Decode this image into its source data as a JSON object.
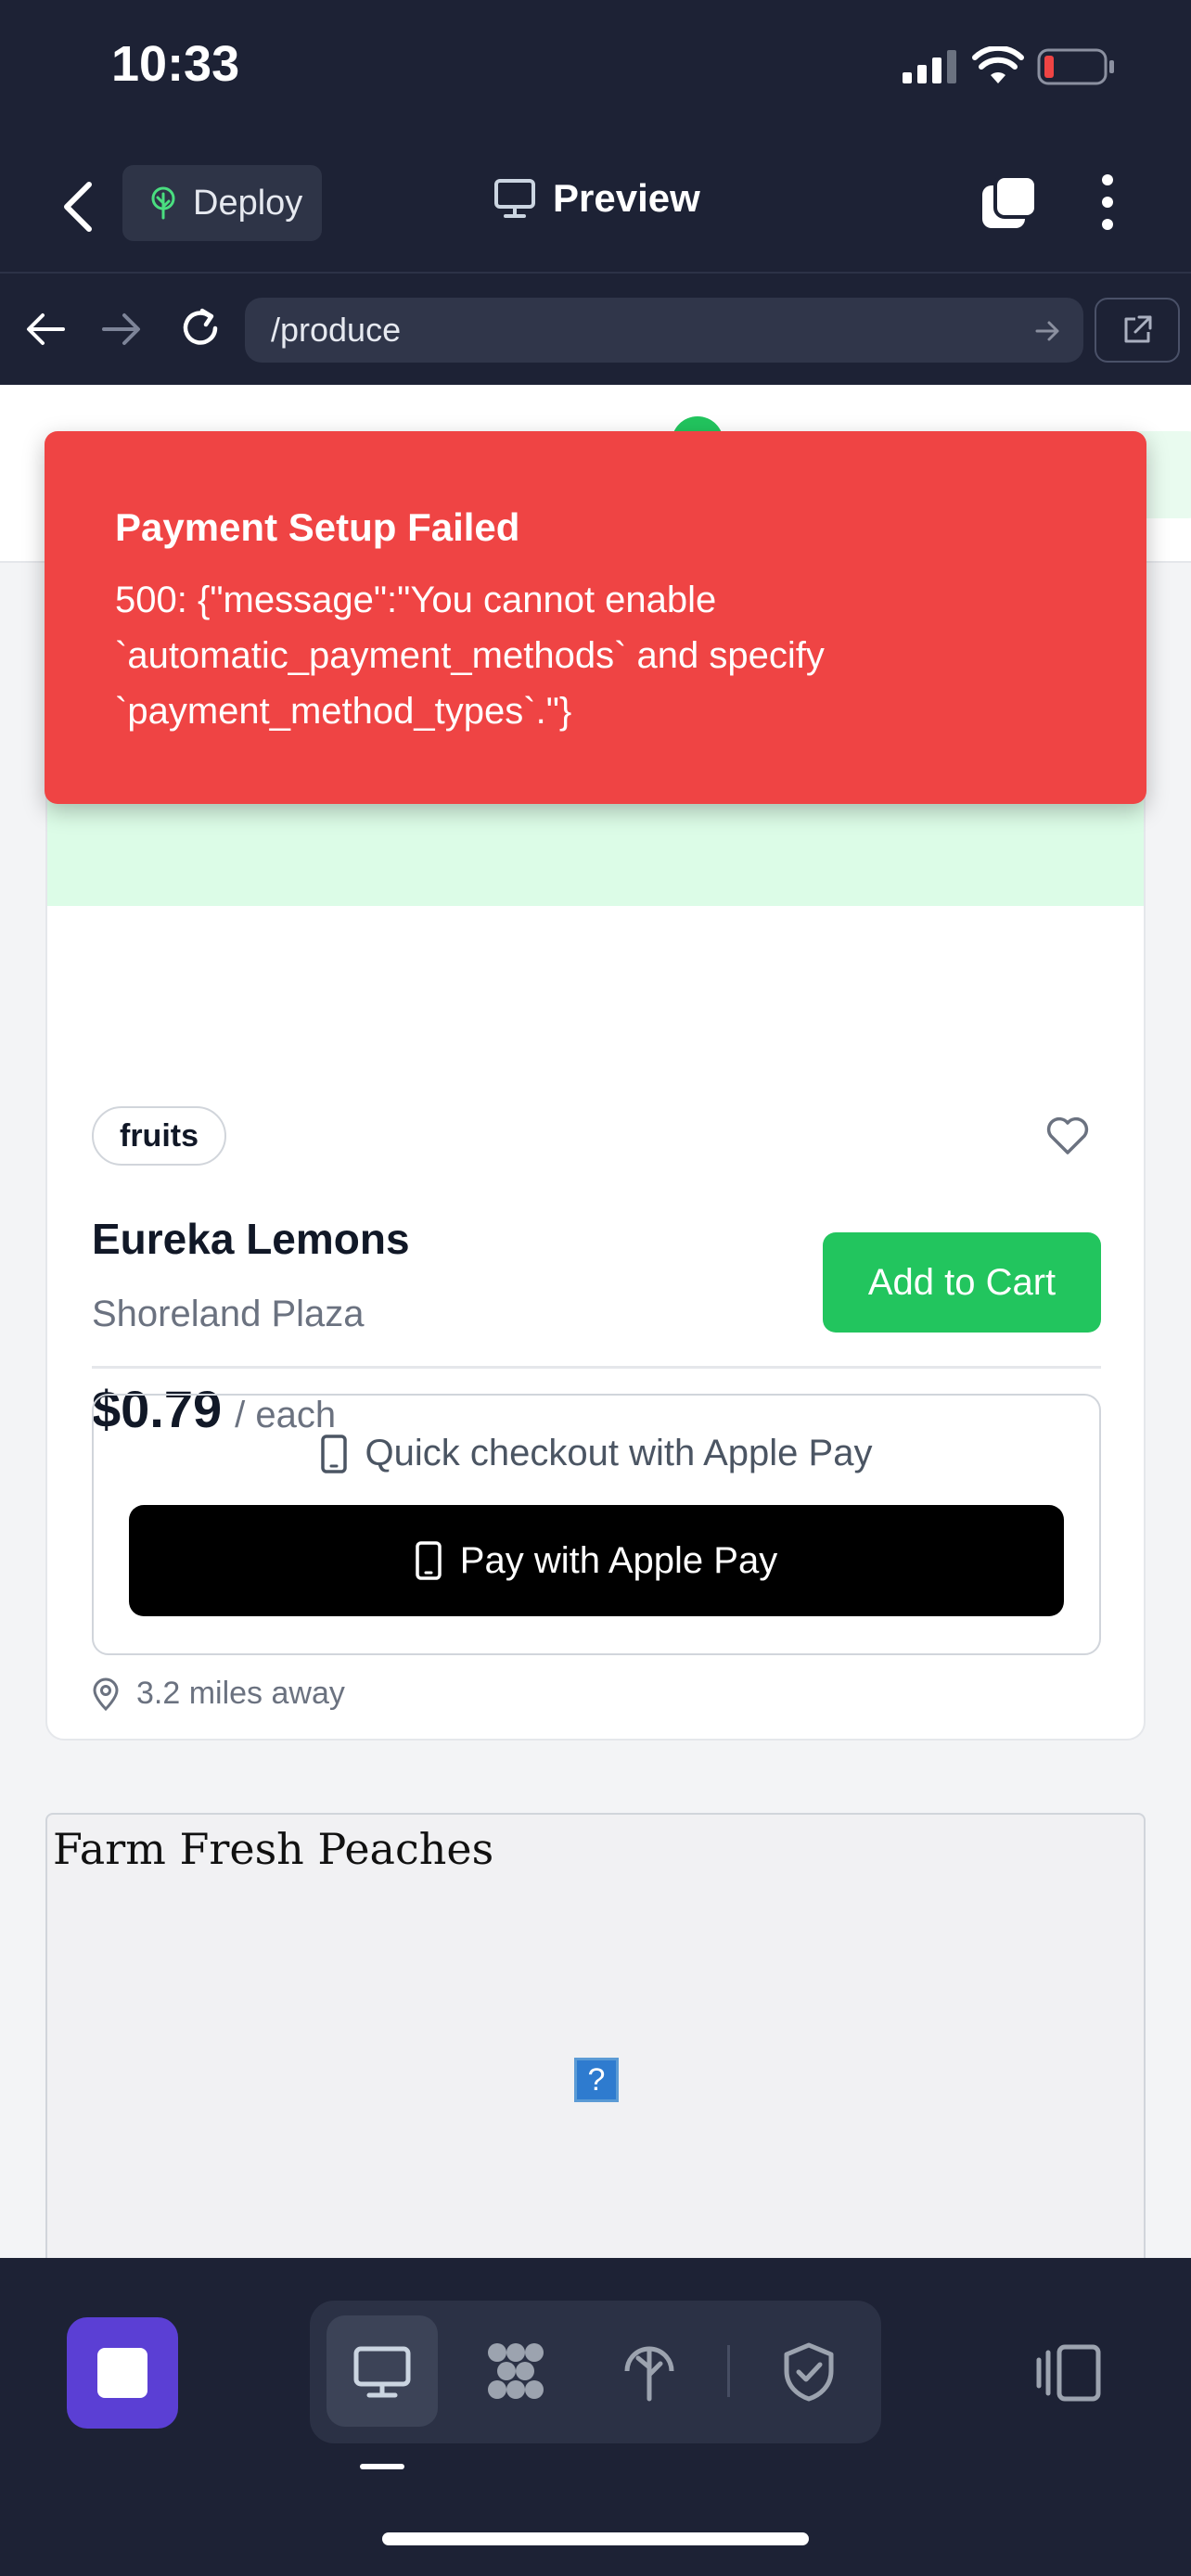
{
  "status_bar": {
    "time": "10:33"
  },
  "header": {
    "deploy_label": "Deploy",
    "title": "Preview"
  },
  "browser": {
    "url": "/produce"
  },
  "toast": {
    "title": "Payment Setup Failed",
    "message": "500: {\"message\":\"You cannot enable `automatic_payment_methods` and specify `payment_method_types`.\"}",
    "color": "#ef4444"
  },
  "product": {
    "tag": "fruits",
    "name": "Eureka Lemons",
    "store": "Shoreland Plaza",
    "price": "$0.79",
    "unit": "/ each",
    "add_to_cart_label": "Add to Cart",
    "apple_pay_caption": "Quick checkout with Apple Pay",
    "apple_pay_button": "Pay with Apple Pay",
    "distance": "3.2 miles away"
  },
  "next_product": {
    "title": "Farm Fresh Peaches",
    "broken_image_glyph": "?"
  },
  "colors": {
    "accent_green": "#22c55e",
    "launcher_purple": "#5b3fd4",
    "app_bg": "#1d2235"
  },
  "dock": {
    "tools": [
      "monitor-icon",
      "cluster-icon",
      "deploy-tree-icon",
      "shield-check-icon"
    ],
    "active_tool": "monitor-icon"
  }
}
